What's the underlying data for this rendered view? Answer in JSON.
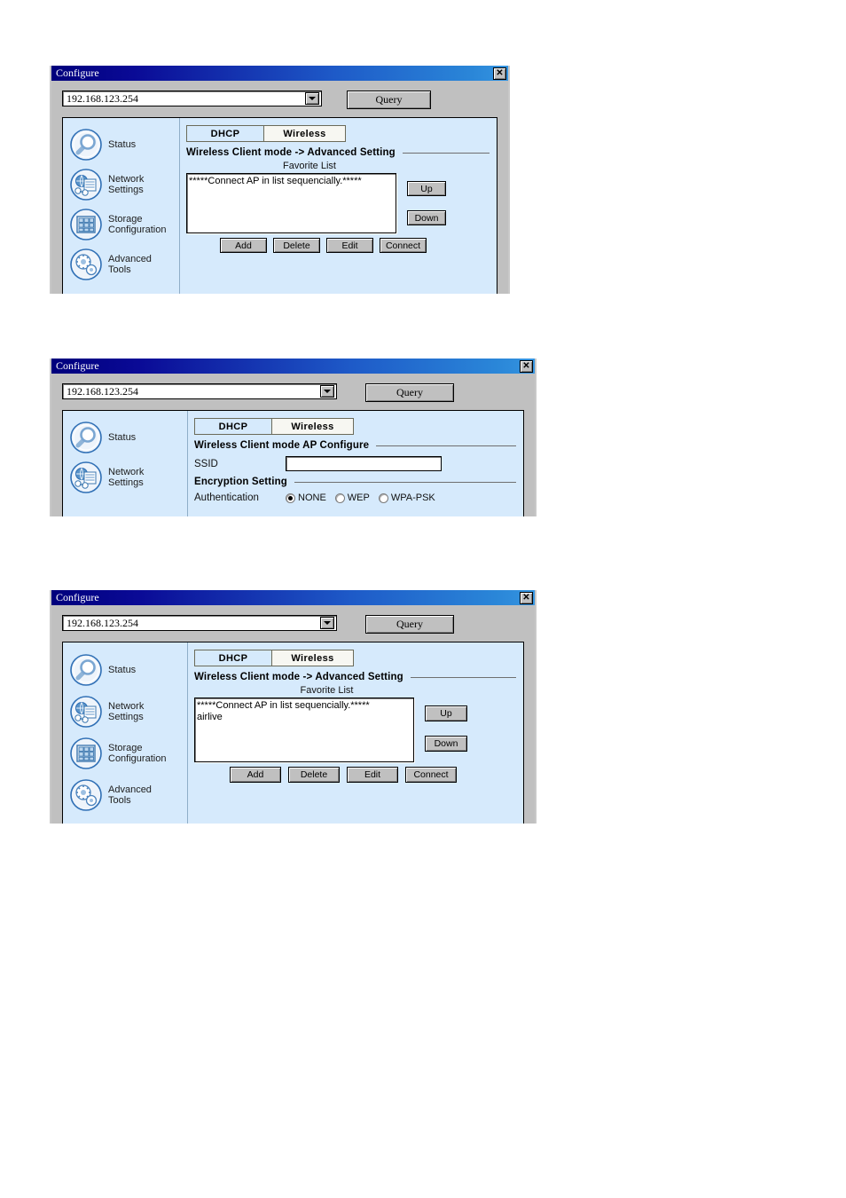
{
  "windows": [
    {
      "title": "Configure",
      "close_label": "✕",
      "address": {
        "value": "192.168.123.254",
        "placeholder": "IP address"
      },
      "query_label": "Query",
      "sidebar": [
        {
          "label": "Status",
          "icon": "magnifier-icon"
        },
        {
          "label": "Network\nSettings",
          "icon": "network-icon"
        },
        {
          "label": "Storage\nConfiguration",
          "icon": "storage-grid-icon"
        },
        {
          "label": "Advanced\nTools",
          "icon": "gears-icon"
        }
      ],
      "tabs": [
        {
          "label": "DHCP",
          "selected": false
        },
        {
          "label": "Wireless",
          "selected": true
        }
      ],
      "section_title": "Wireless Client mode -> Advanced Setting",
      "favorite_caption": "Favorite List",
      "list_items": "*****Connect AP in list sequencially.*****",
      "side_buttons": [
        "Up",
        "Down"
      ],
      "bottom_buttons": [
        "Add",
        "Delete",
        "Edit",
        "Connect"
      ]
    },
    {
      "title": "Configure",
      "close_label": "✕",
      "address": {
        "value": "192.168.123.254",
        "placeholder": "IP address"
      },
      "query_label": "Query",
      "sidebar": [
        {
          "label": "Status",
          "icon": "magnifier-icon"
        },
        {
          "label": "Network\nSettings",
          "icon": "network-icon"
        }
      ],
      "tabs": [
        {
          "label": "DHCP",
          "selected": false
        },
        {
          "label": "Wireless",
          "selected": true
        }
      ],
      "section_title": "Wireless Client mode AP Configure",
      "ssid_label": "SSID",
      "ssid_value": "",
      "ssid_placeholder": "",
      "encryption_title": "Encryption Setting",
      "auth_label": "Authentication",
      "auth_options": [
        {
          "label": "NONE",
          "selected": true
        },
        {
          "label": "WEP",
          "selected": false
        },
        {
          "label": "WPA-PSK",
          "selected": false
        }
      ]
    },
    {
      "title": "Configure",
      "close_label": "✕",
      "address": {
        "value": "192.168.123.254",
        "placeholder": "IP address"
      },
      "query_label": "Query",
      "sidebar": [
        {
          "label": "Status",
          "icon": "magnifier-icon"
        },
        {
          "label": "Network\nSettings",
          "icon": "network-icon"
        },
        {
          "label": "Storage\nConfiguration",
          "icon": "storage-grid-icon"
        },
        {
          "label": "Advanced\nTools",
          "icon": "gears-icon"
        }
      ],
      "tabs": [
        {
          "label": "DHCP",
          "selected": false
        },
        {
          "label": "Wireless",
          "selected": true
        }
      ],
      "section_title": "Wireless Client mode -> Advanced Setting",
      "favorite_caption": "Favorite List",
      "list_items": "*****Connect AP in list sequencially.*****\nairlive",
      "side_buttons": [
        "Up",
        "Down"
      ],
      "bottom_buttons": [
        "Add",
        "Delete",
        "Edit",
        "Connect"
      ]
    }
  ],
  "colors": {
    "titlebar_start": "#00007c",
    "titlebar_end": "#3494e0",
    "panel_bg": "#d6eafc",
    "window_bg": "#c0c0c0",
    "button_face": "#c0c0c0",
    "selected_tab": "#f7f7f2"
  }
}
